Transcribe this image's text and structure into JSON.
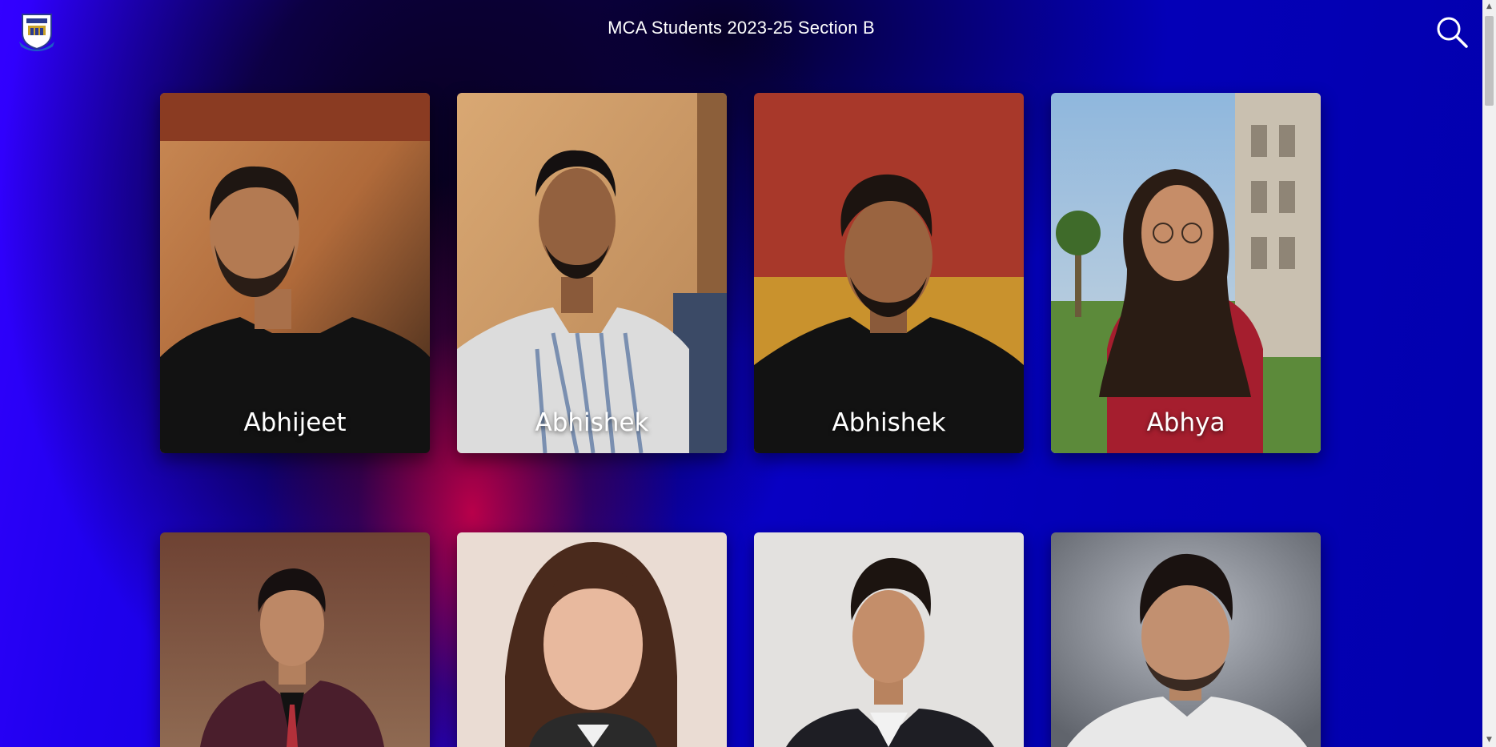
{
  "header": {
    "title": "MCA Students 2023-25 Section B",
    "logo_icon": "college-crest-icon",
    "search_icon": "search-icon"
  },
  "students": {
    "row1": [
      {
        "name": "Abhijeet"
      },
      {
        "name": "Abhishek"
      },
      {
        "name": "Abhishek"
      },
      {
        "name": "Abhya"
      }
    ],
    "row2": [
      {
        "name": ""
      },
      {
        "name": ""
      },
      {
        "name": ""
      },
      {
        "name": ""
      }
    ]
  },
  "colors": {
    "background_primary": "#0a00c8",
    "background_accent": "#d60046",
    "text": "#ffffff"
  }
}
